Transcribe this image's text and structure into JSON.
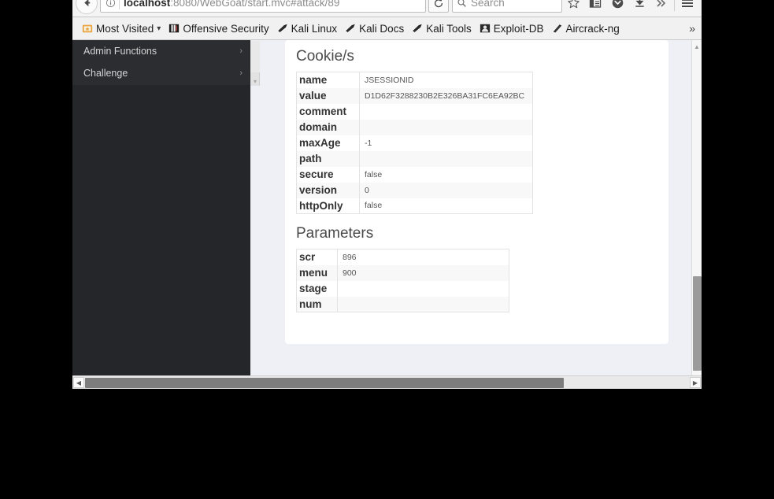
{
  "browser": {
    "back_icon": "back-arrow-icon",
    "forward_icon": "forward-arrow-icon",
    "identity_icon": "info-circle-icon",
    "url_prefix": "localhost",
    "url_suffix": ":8080/WebGoat/start.mvc#attack/89",
    "reload_icon": "reload-icon",
    "search_icon": "search-icon",
    "search_placeholder": "Search",
    "bookmark_star_icon": "star-icon",
    "reader_icon": "reading-list-icon",
    "pocket_icon": "pocket-icon",
    "downloads_icon": "download-arrow-icon",
    "overflow_icon": "chevrons-right-icon",
    "menu_icon": "hamburger-menu-icon"
  },
  "bookmarks": {
    "items": [
      {
        "label": "Most Visited",
        "icon": "folder-star-icon",
        "has_dropdown": true,
        "caret": "▾"
      },
      {
        "label": "Offensive Security",
        "icon": "offensive-security-icon",
        "has_dropdown": false,
        "caret": ""
      },
      {
        "label": "Kali Linux",
        "icon": "kali-dragon-icon",
        "has_dropdown": false,
        "caret": ""
      },
      {
        "label": "Kali Docs",
        "icon": "kali-dragon-icon",
        "has_dropdown": false,
        "caret": ""
      },
      {
        "label": "Kali Tools",
        "icon": "kali-dragon-icon",
        "has_dropdown": false,
        "caret": ""
      },
      {
        "label": "Exploit-DB",
        "icon": "exploit-db-icon",
        "has_dropdown": false,
        "caret": ""
      },
      {
        "label": "Aircrack-ng",
        "icon": "aircrack-ng-icon",
        "has_dropdown": false,
        "caret": ""
      }
    ],
    "overflow_label": "»"
  },
  "sidebar": {
    "items": [
      {
        "label": "Admin Functions",
        "chevron": "›"
      },
      {
        "label": "Challenge",
        "chevron": "›"
      }
    ],
    "scroll_down_arrow": "▾"
  },
  "content": {
    "cookies_title": "Cookie/s",
    "cookies_rows": [
      {
        "key": "name",
        "value": "JSESSIONID"
      },
      {
        "key": "value",
        "value": "D1D62F3288230B2E326BA31FC6EA92BC"
      },
      {
        "key": "comment",
        "value": ""
      },
      {
        "key": "domain",
        "value": ""
      },
      {
        "key": "maxAge",
        "value": "-1"
      },
      {
        "key": "path",
        "value": ""
      },
      {
        "key": "secure",
        "value": "false"
      },
      {
        "key": "version",
        "value": "0"
      },
      {
        "key": "httpOnly",
        "value": "false"
      }
    ],
    "parameters_title": "Parameters",
    "parameters_rows": [
      {
        "key": "scr",
        "value": "896"
      },
      {
        "key": "menu",
        "value": "900"
      },
      {
        "key": "stage",
        "value": ""
      },
      {
        "key": "num",
        "value": ""
      }
    ]
  },
  "scrollbars": {
    "v_up_arrow": "▲",
    "v_down_arrow": "▼",
    "h_left_arrow": "◀",
    "h_right_arrow": "▶"
  },
  "colors": {
    "sidebar_bg": "#25262a",
    "page_bg": "#eef0f5",
    "card_bg": "#ffffff",
    "toolbar_bg": "#f1f1f1",
    "desktop_bg": "#000000"
  }
}
